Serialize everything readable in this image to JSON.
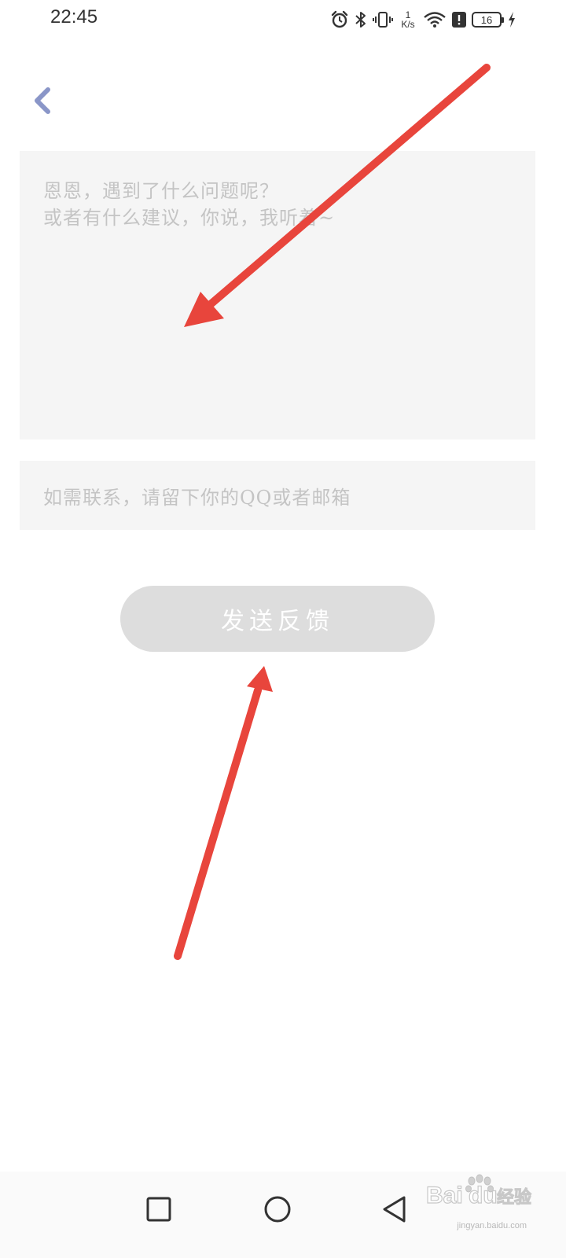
{
  "status_bar": {
    "time": "22:45",
    "net_speed_value": "1",
    "net_speed_unit": "K/s",
    "battery_level": "16",
    "icons": [
      "alarm-icon",
      "bluetooth-icon",
      "vibrate-icon",
      "wifi-icon",
      "alert-icon",
      "battery-icon",
      "charging-icon"
    ]
  },
  "header": {
    "back_icon": "chevron-left-icon",
    "back_color": "#8a96c8"
  },
  "feedback": {
    "placeholder": "恩恩，遇到了什么问题呢？\n或者有什么建议，你说，我听着~"
  },
  "contact": {
    "placeholder": "如需联系，请留下你的QQ或者邮箱"
  },
  "submit": {
    "label": "发送反馈"
  },
  "annotations": {
    "arrow_color": "#e8453c",
    "arrow_count": 2
  },
  "nav_bar": {
    "recent_icon": "square-icon",
    "home_icon": "circle-icon",
    "back_icon": "triangle-back-icon"
  },
  "watermark": {
    "brand": "Baidu经验",
    "url": "jingyan.baidu.com"
  }
}
